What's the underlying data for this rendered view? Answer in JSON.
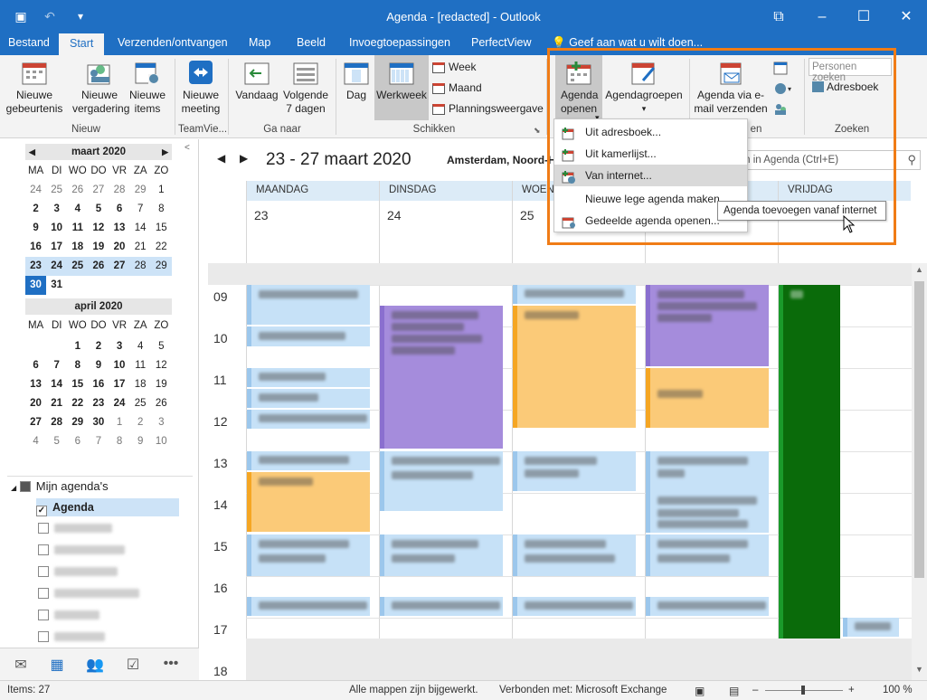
{
  "window": {
    "title": "Agenda - [redacted] - Outlook"
  },
  "tabs": [
    {
      "label": "Bestand"
    },
    {
      "label": "Start"
    },
    {
      "label": "Verzenden/ontvangen"
    },
    {
      "label": "Map"
    },
    {
      "label": "Beeld"
    },
    {
      "label": "Invoegtoepassingen"
    },
    {
      "label": "PerfectView"
    }
  ],
  "tellme": "Geef aan wat u wilt doen...",
  "ribbon": {
    "new_event": "Nieuwe gebeurtenis",
    "new_meeting": "Nieuwe vergadering",
    "new_items": "Nieuwe items",
    "teamviewer_meeting": "Nieuwe meeting",
    "today": "Vandaag",
    "next7": "Volgende 7 dagen",
    "day": "Dag",
    "workweek": "Werkweek",
    "week": "Week",
    "month": "Maand",
    "schedule": "Planningsweergave",
    "open_calendar": "Agenda openen",
    "calendar_groups": "Agendagroepen",
    "email_calendar": "Agenda via e-mail verzenden",
    "people_search_placeholder": "Personen zoeken",
    "address_book": "Adresboek",
    "groups": {
      "new": "Nieuw",
      "teamviewer": "TeamVie...",
      "goto": "Ga naar",
      "arrange": "Schikken",
      "share": "en",
      "find": "Zoeken"
    }
  },
  "dropdown": {
    "items": [
      {
        "label": "Uit adresboek..."
      },
      {
        "label": "Uit kamerlijst..."
      },
      {
        "label": "Van internet..."
      },
      {
        "label": "Nieuwe lege agenda maken"
      },
      {
        "label": "Gedeelde agenda openen..."
      }
    ],
    "highlighted_index": 2
  },
  "tooltip": "Agenda toevoegen vanaf internet",
  "calendar": {
    "range": "23 - 27 maart 2020",
    "location": "Amsterdam, Noord-H",
    "search_placeholder": "ken in Agenda (Ctrl+E)",
    "days": [
      {
        "name": "MAANDAG",
        "num": "23"
      },
      {
        "name": "DINSDAG",
        "num": "24"
      },
      {
        "name": "WOENS",
        "num": "25"
      },
      {
        "name": "",
        "num": ""
      },
      {
        "name": "VRIJDAG",
        "num": ""
      }
    ],
    "hours": [
      "09",
      "10",
      "11",
      "12",
      "13",
      "14",
      "15",
      "16",
      "17",
      "18"
    ]
  },
  "mini_march": {
    "title": "maart 2020",
    "weekdays": [
      "MA",
      "DI",
      "WO",
      "DO",
      "VR",
      "ZA",
      "ZO"
    ],
    "cells": [
      "24",
      "25",
      "26",
      "27",
      "28",
      "29",
      "1",
      "2",
      "3",
      "4",
      "5",
      "6",
      "7",
      "8",
      "9",
      "10",
      "11",
      "12",
      "13",
      "14",
      "15",
      "16",
      "17",
      "18",
      "19",
      "20",
      "21",
      "22",
      "23",
      "24",
      "25",
      "26",
      "27",
      "28",
      "29",
      "30",
      "31"
    ]
  },
  "mini_april": {
    "title": "april 2020",
    "weekdays": [
      "MA",
      "DI",
      "WO",
      "DO",
      "VR",
      "ZA",
      "ZO"
    ],
    "cells": [
      "",
      "",
      "1",
      "2",
      "3",
      "4",
      "5",
      "6",
      "7",
      "8",
      "9",
      "10",
      "11",
      "12",
      "13",
      "14",
      "15",
      "16",
      "17",
      "18",
      "19",
      "20",
      "21",
      "22",
      "23",
      "24",
      "25",
      "26",
      "27",
      "28",
      "29",
      "30",
      "1",
      "2",
      "3",
      "4",
      "5",
      "6",
      "7",
      "8",
      "9",
      "10"
    ]
  },
  "folders": {
    "group": "Mijn agenda's",
    "agenda": "Agenda"
  },
  "status": {
    "items": "Items: 27",
    "sync": "Alle mappen zijn bijgewerkt.",
    "connection": "Verbonden met: Microsoft Exchange",
    "zoom": "100 %"
  },
  "colors": {
    "accent": "#1f6fc3",
    "highlight_box": "#f07c16",
    "event_blue": "#c6e1f7",
    "event_purple": "#a58cdc",
    "event_orange": "#fbca78",
    "event_green": "#0a6b0a"
  }
}
